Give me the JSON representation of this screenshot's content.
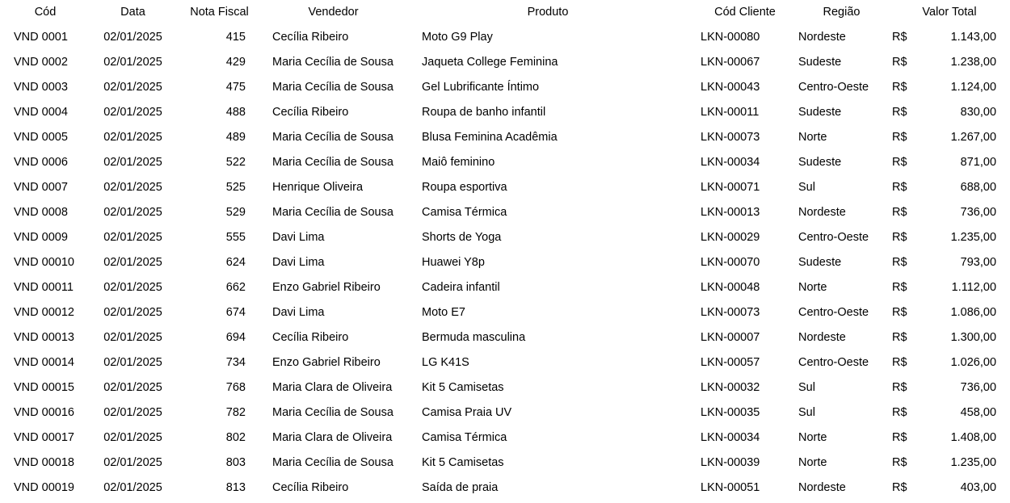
{
  "table": {
    "columns": [
      {
        "key": "cod",
        "label": "Cód"
      },
      {
        "key": "data",
        "label": "Data"
      },
      {
        "key": "nf",
        "label": "Nota Fiscal"
      },
      {
        "key": "vend",
        "label": "Vendedor"
      },
      {
        "key": "prod",
        "label": "Produto"
      },
      {
        "key": "cli",
        "label": "Cód Cliente"
      },
      {
        "key": "reg",
        "label": "Região"
      },
      {
        "key": "val",
        "label": "Valor Total"
      }
    ],
    "currency_symbol": "R$",
    "rows": [
      {
        "cod": "VND 0001",
        "data": "02/01/2025",
        "nf": "415",
        "vend": "Cecília Ribeiro",
        "prod": "Moto G9 Play",
        "cli": "LKN-00080",
        "reg": "Nordeste",
        "cur": "R$",
        "val": "1.143,00"
      },
      {
        "cod": "VND 0002",
        "data": "02/01/2025",
        "nf": "429",
        "vend": "Maria Cecília de Sousa",
        "prod": "Jaqueta College Feminina",
        "cli": "LKN-00067",
        "reg": "Sudeste",
        "cur": "R$",
        "val": "1.238,00"
      },
      {
        "cod": "VND 0003",
        "data": "02/01/2025",
        "nf": "475",
        "vend": "Maria Cecília de Sousa",
        "prod": "Gel Lubrificante Íntimo",
        "cli": "LKN-00043",
        "reg": "Centro-Oeste",
        "cur": "R$",
        "val": "1.124,00"
      },
      {
        "cod": "VND 0004",
        "data": "02/01/2025",
        "nf": "488",
        "vend": "Cecília Ribeiro",
        "prod": "Roupa de banho infantil",
        "cli": "LKN-00011",
        "reg": "Sudeste",
        "cur": "R$",
        "val": "830,00"
      },
      {
        "cod": "VND 0005",
        "data": "02/01/2025",
        "nf": "489",
        "vend": "Maria Cecília de Sousa",
        "prod": "Blusa Feminina Acadêmia",
        "cli": "LKN-00073",
        "reg": "Norte",
        "cur": "R$",
        "val": "1.267,00"
      },
      {
        "cod": "VND 0006",
        "data": "02/01/2025",
        "nf": "522",
        "vend": "Maria Cecília de Sousa",
        "prod": "Maiô feminino",
        "cli": "LKN-00034",
        "reg": "Sudeste",
        "cur": "R$",
        "val": "871,00"
      },
      {
        "cod": "VND 0007",
        "data": "02/01/2025",
        "nf": "525",
        "vend": "Henrique Oliveira",
        "prod": "Roupa esportiva",
        "cli": "LKN-00071",
        "reg": "Sul",
        "cur": "R$",
        "val": "688,00"
      },
      {
        "cod": "VND 0008",
        "data": "02/01/2025",
        "nf": "529",
        "vend": "Maria Cecília de Sousa",
        "prod": "Camisa Térmica",
        "cli": "LKN-00013",
        "reg": "Nordeste",
        "cur": "R$",
        "val": "736,00"
      },
      {
        "cod": "VND 0009",
        "data": "02/01/2025",
        "nf": "555",
        "vend": "Davi Lima",
        "prod": "Shorts de Yoga",
        "cli": "LKN-00029",
        "reg": "Centro-Oeste",
        "cur": "R$",
        "val": "1.235,00"
      },
      {
        "cod": "VND 00010",
        "data": "02/01/2025",
        "nf": "624",
        "vend": "Davi Lima",
        "prod": "Huawei Y8p",
        "cli": "LKN-00070",
        "reg": "Sudeste",
        "cur": "R$",
        "val": "793,00"
      },
      {
        "cod": "VND 00011",
        "data": "02/01/2025",
        "nf": "662",
        "vend": "Enzo Gabriel Ribeiro",
        "prod": "Cadeira infantil",
        "cli": "LKN-00048",
        "reg": "Norte",
        "cur": "R$",
        "val": "1.112,00"
      },
      {
        "cod": "VND 00012",
        "data": "02/01/2025",
        "nf": "674",
        "vend": "Davi Lima",
        "prod": "Moto E7",
        "cli": "LKN-00073",
        "reg": "Centro-Oeste",
        "cur": "R$",
        "val": "1.086,00"
      },
      {
        "cod": "VND 00013",
        "data": "02/01/2025",
        "nf": "694",
        "vend": "Cecília Ribeiro",
        "prod": "Bermuda masculina",
        "cli": "LKN-00007",
        "reg": "Nordeste",
        "cur": "R$",
        "val": "1.300,00"
      },
      {
        "cod": "VND 00014",
        "data": "02/01/2025",
        "nf": "734",
        "vend": "Enzo Gabriel Ribeiro",
        "prod": "LG K41S",
        "cli": "LKN-00057",
        "reg": "Centro-Oeste",
        "cur": "R$",
        "val": "1.026,00"
      },
      {
        "cod": "VND 00015",
        "data": "02/01/2025",
        "nf": "768",
        "vend": "Maria Clara de Oliveira",
        "prod": "Kit 5 Camisetas",
        "cli": "LKN-00032",
        "reg": "Sul",
        "cur": "R$",
        "val": "736,00"
      },
      {
        "cod": "VND 00016",
        "data": "02/01/2025",
        "nf": "782",
        "vend": "Maria Cecília de Sousa",
        "prod": "Camisa Praia UV",
        "cli": "LKN-00035",
        "reg": "Sul",
        "cur": "R$",
        "val": "458,00"
      },
      {
        "cod": "VND 00017",
        "data": "02/01/2025",
        "nf": "802",
        "vend": "Maria Clara de Oliveira",
        "prod": "Camisa Térmica",
        "cli": "LKN-00034",
        "reg": "Norte",
        "cur": "R$",
        "val": "1.408,00"
      },
      {
        "cod": "VND 00018",
        "data": "02/01/2025",
        "nf": "803",
        "vend": "Maria Cecília de Sousa",
        "prod": "Kit 5 Camisetas",
        "cli": "LKN-00039",
        "reg": "Norte",
        "cur": "R$",
        "val": "1.235,00"
      },
      {
        "cod": "VND 00019",
        "data": "02/01/2025",
        "nf": "813",
        "vend": "Cecília Ribeiro",
        "prod": "Saída de praia",
        "cli": "LKN-00051",
        "reg": "Nordeste",
        "cur": "R$",
        "val": "403,00"
      }
    ]
  }
}
